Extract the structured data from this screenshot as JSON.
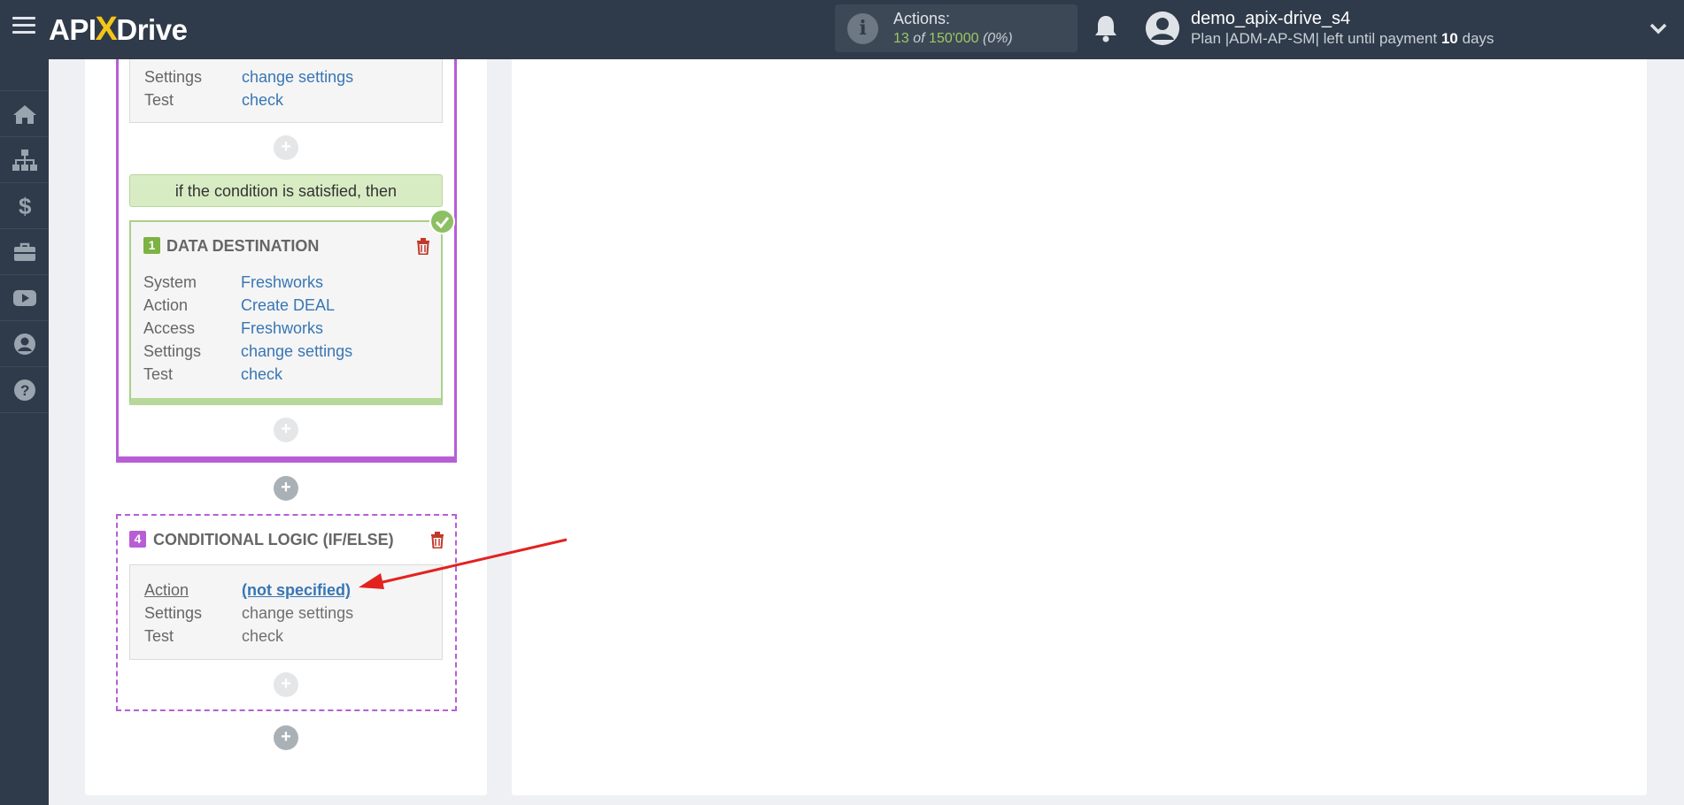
{
  "header": {
    "logo_prefix": "API",
    "logo_x": "X",
    "logo_suffix": "Drive",
    "actions_label": "Actions:",
    "actions_used": "13",
    "actions_of": "of",
    "actions_total": "150'000",
    "actions_percent": "(0%)",
    "username": "demo_apix-drive_s4",
    "plan_text": "Plan |ADM-AP-SM| left until payment",
    "plan_days": "10",
    "plan_days_unit": "days"
  },
  "sidebar": {
    "items": [
      {
        "icon": "home-icon"
      },
      {
        "icon": "sitemap-icon"
      },
      {
        "icon": "dollar-icon"
      },
      {
        "icon": "briefcase-icon"
      },
      {
        "icon": "youtube-icon"
      },
      {
        "icon": "user-icon"
      },
      {
        "icon": "help-icon"
      }
    ]
  },
  "flow": {
    "top_card": {
      "rows": [
        {
          "label": "Settings",
          "value": "change settings"
        },
        {
          "label": "Test",
          "value": "check"
        }
      ]
    },
    "condition_text": "if the condition is satisfied, then",
    "destination": {
      "number": "1",
      "title": "DATA DESTINATION",
      "rows": [
        {
          "label": "System",
          "value": "Freshworks"
        },
        {
          "label": "Action",
          "value": "Create DEAL"
        },
        {
          "label": "Access",
          "value": "Freshworks"
        },
        {
          "label": "Settings",
          "value": "change settings"
        },
        {
          "label": "Test",
          "value": "check"
        }
      ]
    },
    "logic": {
      "number": "4",
      "title": "CONDITIONAL LOGIC (IF/ELSE)",
      "rows": [
        {
          "label": "Action",
          "value": "(not specified)"
        },
        {
          "label": "Settings",
          "value": "change settings"
        },
        {
          "label": "Test",
          "value": "check"
        }
      ]
    }
  },
  "colors": {
    "topbar": "#2f3b4a",
    "accent_purple": "#b75ed6",
    "accent_green": "#8cc063",
    "link": "#3876b4",
    "arrow_red": "#e3221f",
    "trash_red": "#c0392b"
  }
}
